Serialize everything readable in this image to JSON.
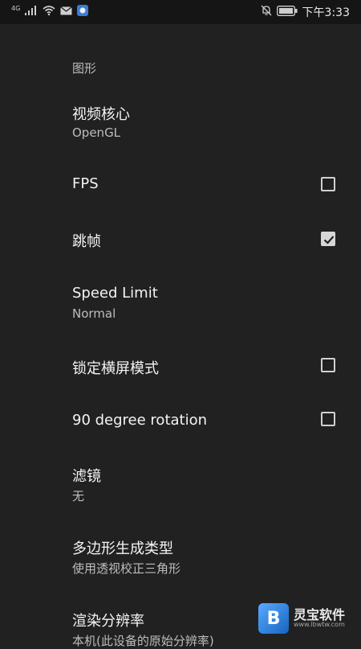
{
  "status_bar": {
    "network": "4G",
    "time": "下午3:33"
  },
  "section_title": "图形",
  "settings": {
    "video_core": {
      "title": "视频核心",
      "value": "OpenGL"
    },
    "fps": {
      "title": "FPS",
      "checked": false
    },
    "frame_skip": {
      "title": "跳帧",
      "checked": true
    },
    "speed_limit": {
      "title": "Speed Limit",
      "value": "Normal"
    },
    "lock_landscape": {
      "title": "锁定横屏模式",
      "checked": false
    },
    "rotation": {
      "title": "90 degree rotation",
      "checked": false
    },
    "filter": {
      "title": "滤镜",
      "value": "无"
    },
    "polygon": {
      "title": "多边形生成类型",
      "value": "使用透视校正三角形"
    },
    "resolution": {
      "title": "渲染分辨率",
      "value": "本机(此设备的原始分辨率)"
    }
  },
  "watermark": {
    "name": "灵宝软件",
    "url": "www.lbwtw.com"
  }
}
